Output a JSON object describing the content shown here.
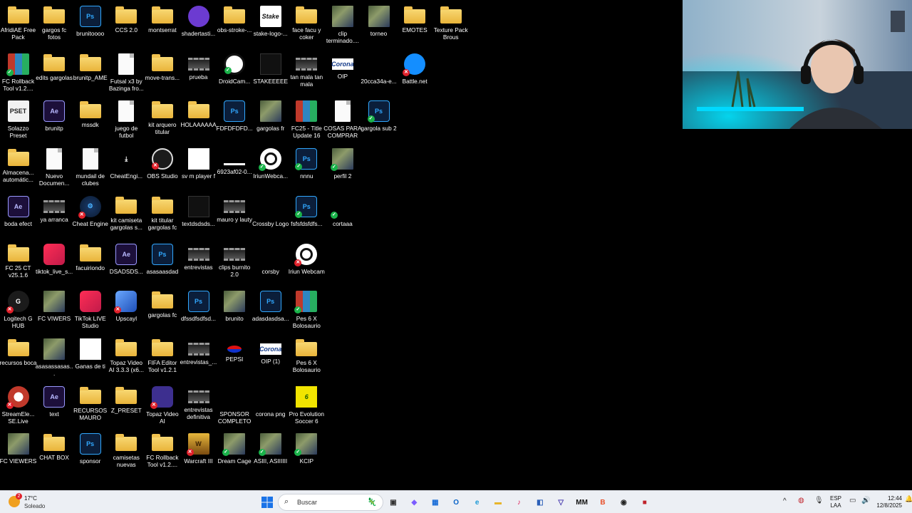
{
  "desktop": {
    "icons": [
      {
        "label": "AfridiAE Free Pack",
        "kind": "folder",
        "badge": ""
      },
      {
        "label": "gargos fc fotos",
        "kind": "folder",
        "badge": ""
      },
      {
        "label": "brunitoooo",
        "kind": "ps",
        "badge": ""
      },
      {
        "label": "CCS 2.0",
        "kind": "folder",
        "badge": ""
      },
      {
        "label": "montserrat",
        "kind": "folder",
        "badge": ""
      },
      {
        "label": "shadertasti...",
        "kind": "purple",
        "badge": ""
      },
      {
        "label": "obs-stroke-...",
        "kind": "folder",
        "badge": ""
      },
      {
        "label": "stake-logo-...",
        "kind": "stake",
        "badge": ""
      },
      {
        "label": "face facu y coker",
        "kind": "folder",
        "badge": ""
      },
      {
        "label": "clip terminado....",
        "kind": "img",
        "badge": ""
      },
      {
        "label": "torneo",
        "kind": "img",
        "badge": ""
      },
      {
        "label": "EMOTES",
        "kind": "folder",
        "badge": ""
      },
      {
        "label": "Texture Pack Brous",
        "kind": "folder",
        "badge": ""
      },
      {
        "label": "FC Rollback Tool v1.2....",
        "kind": "rar",
        "badge": "ok"
      },
      {
        "label": "edits gargolas",
        "kind": "folder",
        "badge": ""
      },
      {
        "label": "brunitp_AME",
        "kind": "folder",
        "badge": ""
      },
      {
        "label": "Futsal x3  by Bazinga fro...",
        "kind": "doc",
        "badge": ""
      },
      {
        "label": "move-trans...",
        "kind": "folder",
        "badge": ""
      },
      {
        "label": "prueba",
        "kind": "vid",
        "badge": ""
      },
      {
        "label": "DroidCam...",
        "kind": "droid",
        "badge": "ok"
      },
      {
        "label": "STAKEEEEE",
        "kind": "dark",
        "badge": ""
      },
      {
        "label": "tan mala tan mala",
        "kind": "vid",
        "badge": ""
      },
      {
        "label": "OIP",
        "kind": "corona",
        "badge": ""
      },
      {
        "label": "20cca34a-e...",
        "kind": "blank",
        "badge": ""
      },
      {
        "label": "Battle.net",
        "kind": "battlenet",
        "badge": "err"
      },
      {
        "label": "Solazzo Preset",
        "kind": "pset",
        "badge": ""
      },
      {
        "label": "brunitp",
        "kind": "ae",
        "badge": ""
      },
      {
        "label": "mssdk",
        "kind": "folder",
        "badge": ""
      },
      {
        "label": "juego de futbol",
        "kind": "doc",
        "badge": ""
      },
      {
        "label": "kit arquero titular",
        "kind": "folder",
        "badge": ""
      },
      {
        "label": "HOLAAAAAA",
        "kind": "folder",
        "badge": ""
      },
      {
        "label": "FDFDFDFD...",
        "kind": "ps",
        "badge": ""
      },
      {
        "label": "gargolas fr",
        "kind": "img",
        "badge": ""
      },
      {
        "label": "FC25 - Title Update 16",
        "kind": "rar",
        "badge": ""
      },
      {
        "label": "COSAS PARA COMPRAR",
        "kind": "doc",
        "badge": ""
      },
      {
        "label": "gargola sub 2",
        "kind": "ps",
        "badge": "ok"
      },
      {
        "label": "Almacena... automátic...",
        "kind": "folder",
        "badge": ""
      },
      {
        "label": "Nuevo Documen...",
        "kind": "doc",
        "badge": ""
      },
      {
        "label": "mundail de clubes",
        "kind": "doc",
        "badge": ""
      },
      {
        "label": "CheatEngi...",
        "kind": "dl",
        "badge": ""
      },
      {
        "label": "OBS Studio",
        "kind": "obs",
        "badge": "err"
      },
      {
        "label": "sv m player f",
        "kind": "white",
        "badge": ""
      },
      {
        "label": "6923af02-0...",
        "kind": "bar",
        "badge": ""
      },
      {
        "label": "IriunWebca...",
        "kind": "iriun",
        "badge": "ok"
      },
      {
        "label": "nnnu",
        "kind": "ps",
        "badge": "ok"
      },
      {
        "label": "perfil 2",
        "kind": "img",
        "badge": "ok"
      },
      {
        "label": "boda efect",
        "kind": "ae",
        "badge": ""
      },
      {
        "label": "ya arranca",
        "kind": "vid",
        "badge": ""
      },
      {
        "label": "Cheat Engine",
        "kind": "cheat",
        "badge": "err"
      },
      {
        "label": "kit camiseta gargolas s...",
        "kind": "folder",
        "badge": ""
      },
      {
        "label": "kit titular gargolas fc",
        "kind": "folder",
        "badge": ""
      },
      {
        "label": "textdsdsds...",
        "kind": "dark",
        "badge": ""
      },
      {
        "label": "mauro y lauty",
        "kind": "vid",
        "badge": ""
      },
      {
        "label": "Crossby Logo",
        "kind": "blank",
        "badge": ""
      },
      {
        "label": "fsfsfdsfdfs...",
        "kind": "ps",
        "badge": "ok"
      },
      {
        "label": "cortaaa",
        "kind": "blank",
        "badge": "ok"
      },
      {
        "label": "FC 25 CT v25.1.6",
        "kind": "folder",
        "badge": ""
      },
      {
        "label": "tiktok_live_s...",
        "kind": "tiktok",
        "badge": ""
      },
      {
        "label": "facuiriondo",
        "kind": "folder",
        "badge": ""
      },
      {
        "label": "DSADSDS...",
        "kind": "ae",
        "badge": ""
      },
      {
        "label": "asasaasdad",
        "kind": "ps",
        "badge": ""
      },
      {
        "label": "entrevistas",
        "kind": "vid",
        "badge": ""
      },
      {
        "label": "clips burnito 2.0",
        "kind": "vid",
        "badge": ""
      },
      {
        "label": "corsby",
        "kind": "blank",
        "badge": ""
      },
      {
        "label": "Iriun Webcam",
        "kind": "iriun",
        "badge": "err"
      },
      {
        "label": "Logitech G HUB",
        "kind": "logi",
        "badge": "err"
      },
      {
        "label": "FC VIWERS",
        "kind": "img",
        "badge": ""
      },
      {
        "label": "TikTok LIVE Studio",
        "kind": "tiktok",
        "badge": ""
      },
      {
        "label": "Upscayl",
        "kind": "upscayl",
        "badge": "err"
      },
      {
        "label": "gargolas fc",
        "kind": "folder",
        "badge": ""
      },
      {
        "label": "dfssdfsdfsd...",
        "kind": "ps",
        "badge": ""
      },
      {
        "label": "brunito",
        "kind": "img",
        "badge": ""
      },
      {
        "label": "adasdasdsa...",
        "kind": "ps",
        "badge": ""
      },
      {
        "label": "Pes 6 X Bolosaurio",
        "kind": "rar",
        "badge": "ok"
      },
      {
        "label": "recursos boca",
        "kind": "folder",
        "badge": ""
      },
      {
        "label": "asasassasas...",
        "kind": "img",
        "badge": ""
      },
      {
        "label": "Ganas de ti",
        "kind": "white",
        "badge": ""
      },
      {
        "label": "Topaz Video AI 3.3.3 (x6...",
        "kind": "folder",
        "badge": ""
      },
      {
        "label": "FIFA Editor Tool v1.2.1",
        "kind": "folder",
        "badge": ""
      },
      {
        "label": "entrevistas_...",
        "kind": "vid",
        "badge": ""
      },
      {
        "label": "PEPSI",
        "kind": "pepsi",
        "badge": ""
      },
      {
        "label": "OIP (1)",
        "kind": "corona",
        "badge": ""
      },
      {
        "label": "Pes 6 X Bolosaurio",
        "kind": "folder",
        "badge": ""
      },
      {
        "label": "StreamEle... SE.Live",
        "kind": "stream",
        "badge": "err"
      },
      {
        "label": "text",
        "kind": "ae",
        "badge": ""
      },
      {
        "label": "RECURSOS MAURO",
        "kind": "folder",
        "badge": ""
      },
      {
        "label": "Z_PRESET",
        "kind": "folder",
        "badge": ""
      },
      {
        "label": "Topaz Video AI",
        "kind": "topaz",
        "badge": "err"
      },
      {
        "label": "entrevistas definitiva",
        "kind": "vid",
        "badge": ""
      },
      {
        "label": "SPONSOR COMPLETO",
        "kind": "blank",
        "badge": ""
      },
      {
        "label": "corona png",
        "kind": "blank",
        "badge": ""
      },
      {
        "label": "Pro Evolution Soccer 6",
        "kind": "pes",
        "badge": ""
      },
      {
        "label": "FC VIEWERS",
        "kind": "img",
        "badge": ""
      },
      {
        "label": "CHAT BOX",
        "kind": "folder",
        "badge": ""
      },
      {
        "label": "sponsor",
        "kind": "ps",
        "badge": ""
      },
      {
        "label": "camisetas nuevas",
        "kind": "folder",
        "badge": ""
      },
      {
        "label": "FC Rollback Tool v1.2....",
        "kind": "folder",
        "badge": ""
      },
      {
        "label": "Warcraft III",
        "kind": "war3",
        "badge": "err"
      },
      {
        "label": "Dream Cage",
        "kind": "img",
        "badge": "ok"
      },
      {
        "label": "ASIII, ASIIIIII",
        "kind": "img",
        "badge": "ok"
      },
      {
        "label": "KCIP",
        "kind": "img",
        "badge": "ok"
      }
    ]
  },
  "icon_text": {
    "ps": "Ps",
    "ae": "Ae",
    "pset": "PSET",
    "stake": "Stake",
    "war3": "W",
    "pes": "6",
    "logi": "G",
    "dl": "⤓",
    "corona": "Corona",
    "cheat": "⚙"
  },
  "badge_glyph": {
    "ok": "✓",
    "err": "✕"
  },
  "colors": {
    "taskbar": "#eceff4",
    "desktop": "#000000",
    "ok_badge": "#1ab34a",
    "err_badge": "#e0202a"
  },
  "taskbar": {
    "weather": {
      "temp": "17°C",
      "condition": "Soleado",
      "alert_count": "2"
    },
    "search_placeholder": "Buscar",
    "language": {
      "code": "ESP",
      "layout": "LAA"
    },
    "clock": {
      "time": "12:44",
      "date": "12/8/2025"
    },
    "apps": [
      {
        "name": "task-view",
        "glyph": "▣",
        "color": "#333"
      },
      {
        "name": "copilot",
        "glyph": "◆",
        "color": "#7b5cff"
      },
      {
        "name": "store",
        "glyph": "▦",
        "color": "#1a6ed8"
      },
      {
        "name": "outlook",
        "glyph": "O",
        "color": "#0a64c8"
      },
      {
        "name": "edge",
        "glyph": "e",
        "color": "#1d9ad6"
      },
      {
        "name": "file-explorer",
        "glyph": "▬",
        "color": "#e7b52c"
      },
      {
        "name": "tiktok",
        "glyph": "♪",
        "color": "#e0245e"
      },
      {
        "name": "app-blue",
        "glyph": "◧",
        "color": "#2b5fb8"
      },
      {
        "name": "app-shield",
        "glyph": "▽",
        "color": "#4b3fb0"
      },
      {
        "name": "mm",
        "glyph": "MM",
        "color": "#111"
      },
      {
        "name": "brave",
        "glyph": "B",
        "color": "#e8502a"
      },
      {
        "name": "obs",
        "glyph": "◉",
        "color": "#222"
      },
      {
        "name": "recorder",
        "glyph": "■",
        "color": "#c0232b"
      }
    ]
  }
}
